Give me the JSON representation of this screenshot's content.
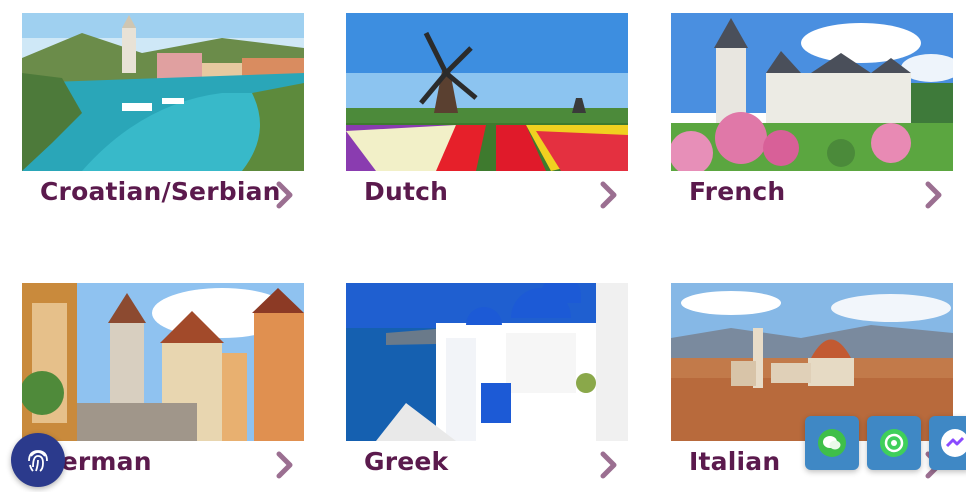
{
  "languages": [
    {
      "label": "Croatian/Serbian",
      "image": "croatia-harbor-photo"
    },
    {
      "label": "Dutch",
      "image": "netherlands-windmill-photo"
    },
    {
      "label": "French",
      "image": "france-chateau-photo"
    },
    {
      "label": "German",
      "image": "germany-town-photo"
    },
    {
      "label": "Greek",
      "image": "santorini-church-photo"
    },
    {
      "label": "Italian",
      "image": "florence-cathedral-photo"
    }
  ],
  "icons": {
    "chevron": "chevron-right-icon",
    "fingerprint": "fingerprint-icon",
    "wechat": "wechat-icon",
    "whatsapp": "whatsapp-icon",
    "messenger": "messenger-icon"
  },
  "colors": {
    "label": "#5b1a4d",
    "chevron": "#9b6f91",
    "fab": "#3f88c5",
    "fingerprint_button": "#2b3a8c"
  }
}
